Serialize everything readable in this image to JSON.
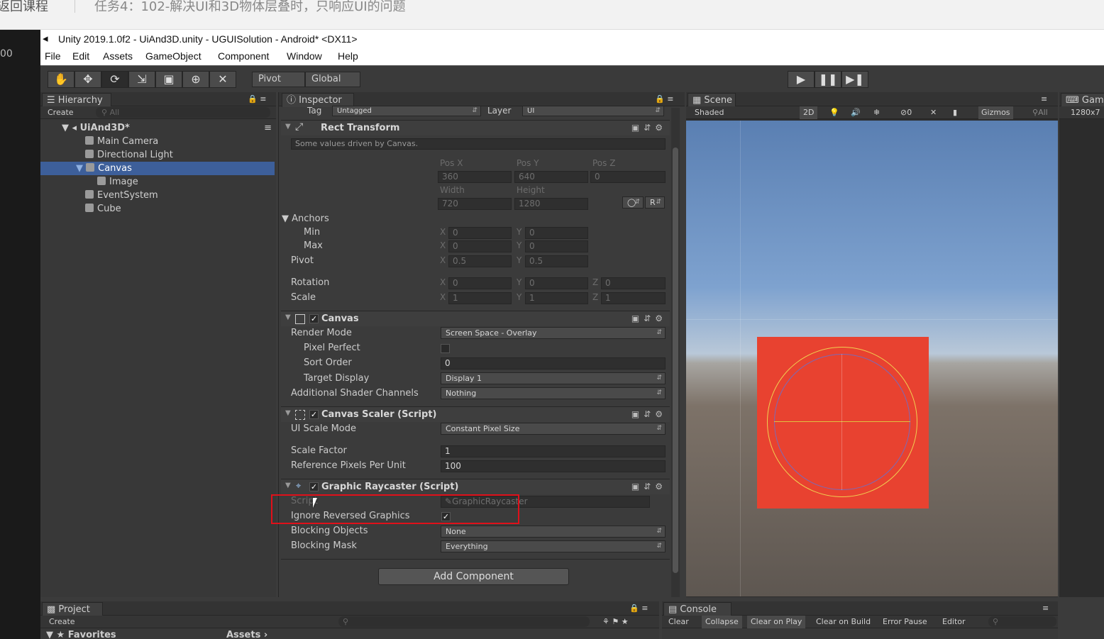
{
  "course_bar": {
    "back_label": "返回课程",
    "task_title": "任务4：102-解决UI和3D物体层叠时，只响应UI的问题"
  },
  "side_strip": {
    "label": "00"
  },
  "window": {
    "title": "Unity 2019.1.0f2 - UiAnd3D.unity - UGUISolution - Android* <DX11>"
  },
  "menu": [
    "File",
    "Edit",
    "Assets",
    "GameObject",
    "Component",
    "Window",
    "Help"
  ],
  "toolbar": {
    "pivot": "Pivot",
    "global": "Global"
  },
  "hierarchy": {
    "tab": "Hierarchy",
    "create": "Create",
    "search_placeholder": "All",
    "scene": "UiAnd3D*",
    "items": [
      "Main Camera",
      "Directional Light",
      "Canvas",
      "Image",
      "EventSystem",
      "Cube"
    ]
  },
  "inspector": {
    "tab": "Inspector",
    "tag_label": "Tag",
    "tag_value": "Untagged",
    "layer_label": "Layer",
    "layer_value": "UI",
    "rect": {
      "title": "Rect Transform",
      "note": "Some values driven by Canvas.",
      "pos_x_label": "Pos X",
      "pos_y_label": "Pos Y",
      "pos_z_label": "Pos Z",
      "pos_x": "360",
      "pos_y": "640",
      "pos_z": "0",
      "width_label": "Width",
      "height_label": "Height",
      "width": "720",
      "height": "1280",
      "r_label": "R",
      "anchors": "Anchors",
      "min": "Min",
      "max": "Max",
      "pivot": "Pivot",
      "rotation": "Rotation",
      "scale": "Scale",
      "x": "X",
      "y": "Y",
      "z": "Z",
      "min_x": "0",
      "min_y": "0",
      "max_x": "0",
      "max_y": "0",
      "pivot_x": "0.5",
      "pivot_y": "0.5",
      "rot_x": "0",
      "rot_y": "0",
      "rot_z": "0",
      "scale_x": "1",
      "scale_y": "1",
      "scale_z": "1"
    },
    "canvas": {
      "title": "Canvas",
      "render_mode_label": "Render Mode",
      "render_mode": "Screen Space - Overlay",
      "pixel_perfect": "Pixel Perfect",
      "sort_order_label": "Sort Order",
      "sort_order": "0",
      "target_display_label": "Target Display",
      "target_display": "Display 1",
      "shader_channels_label": "Additional Shader Channels",
      "shader_channels": "Nothing"
    },
    "scaler": {
      "title": "Canvas Scaler (Script)",
      "ui_scale_mode_label": "UI Scale Mode",
      "ui_scale_mode": "Constant Pixel Size",
      "scale_factor_label": "Scale Factor",
      "scale_factor": "1",
      "ref_ppu_label": "Reference Pixels Per Unit",
      "ref_ppu": "100"
    },
    "raycaster": {
      "title": "Graphic Raycaster (Script)",
      "script_label": "Script",
      "script_value": "GraphicRaycaster",
      "ignore_label": "Ignore Reversed Graphics",
      "blocking_objects_label": "Blocking Objects",
      "blocking_objects": "None",
      "blocking_mask_label": "Blocking Mask",
      "blocking_mask": "Everything"
    },
    "add_component": "Add Component"
  },
  "scene": {
    "tab": "Scene",
    "shaded": "Shaded",
    "mode_2d": "2D",
    "gizmos": "Gizmos",
    "search": "All",
    "audio_count": "0"
  },
  "game": {
    "tab": "Gam",
    "resolution": "1280x7"
  },
  "project": {
    "tab": "Project",
    "create": "Create",
    "favorites": "Favorites",
    "assets": "Assets"
  },
  "console": {
    "tab": "Console",
    "buttons": [
      "Clear",
      "Collapse",
      "Clear on Play",
      "Clear on Build",
      "Error Pause",
      "Editor"
    ]
  },
  "colors": {
    "highlight": "#e0101a",
    "selection": "#3d5f9a",
    "image_red": "#e84230"
  }
}
